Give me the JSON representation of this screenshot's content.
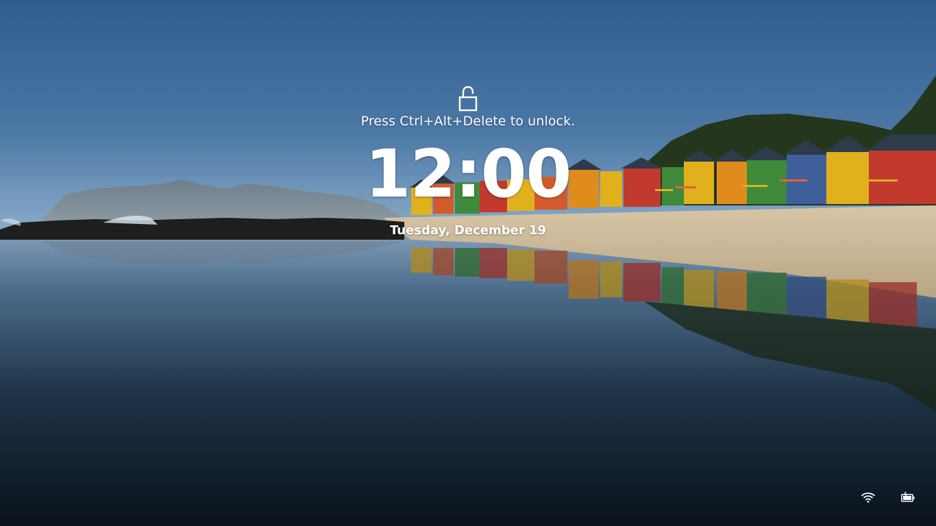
{
  "lock_screen": {
    "unlock_hint": "Press Ctrl+Alt+Delete to unlock.",
    "time": "12:00",
    "date": "Tuesday, December 19",
    "lock_icon": "unlocked-padlock-icon"
  },
  "system_tray": {
    "network_icon": "wifi-icon",
    "battery_icon": "battery-charging-icon"
  },
  "wallpaper": {
    "scene": "beach-huts-reflection",
    "colors": {
      "sky_top": "#2f5d8c",
      "sky_bottom": "#86a6c2",
      "water_dark": "#0c1520",
      "sand": "#cdbb9c",
      "hut_red": "#c23a2e",
      "hut_yellow": "#e0b11d",
      "hut_green": "#3f8a3a",
      "hut_blue": "#3f5f9a"
    }
  }
}
